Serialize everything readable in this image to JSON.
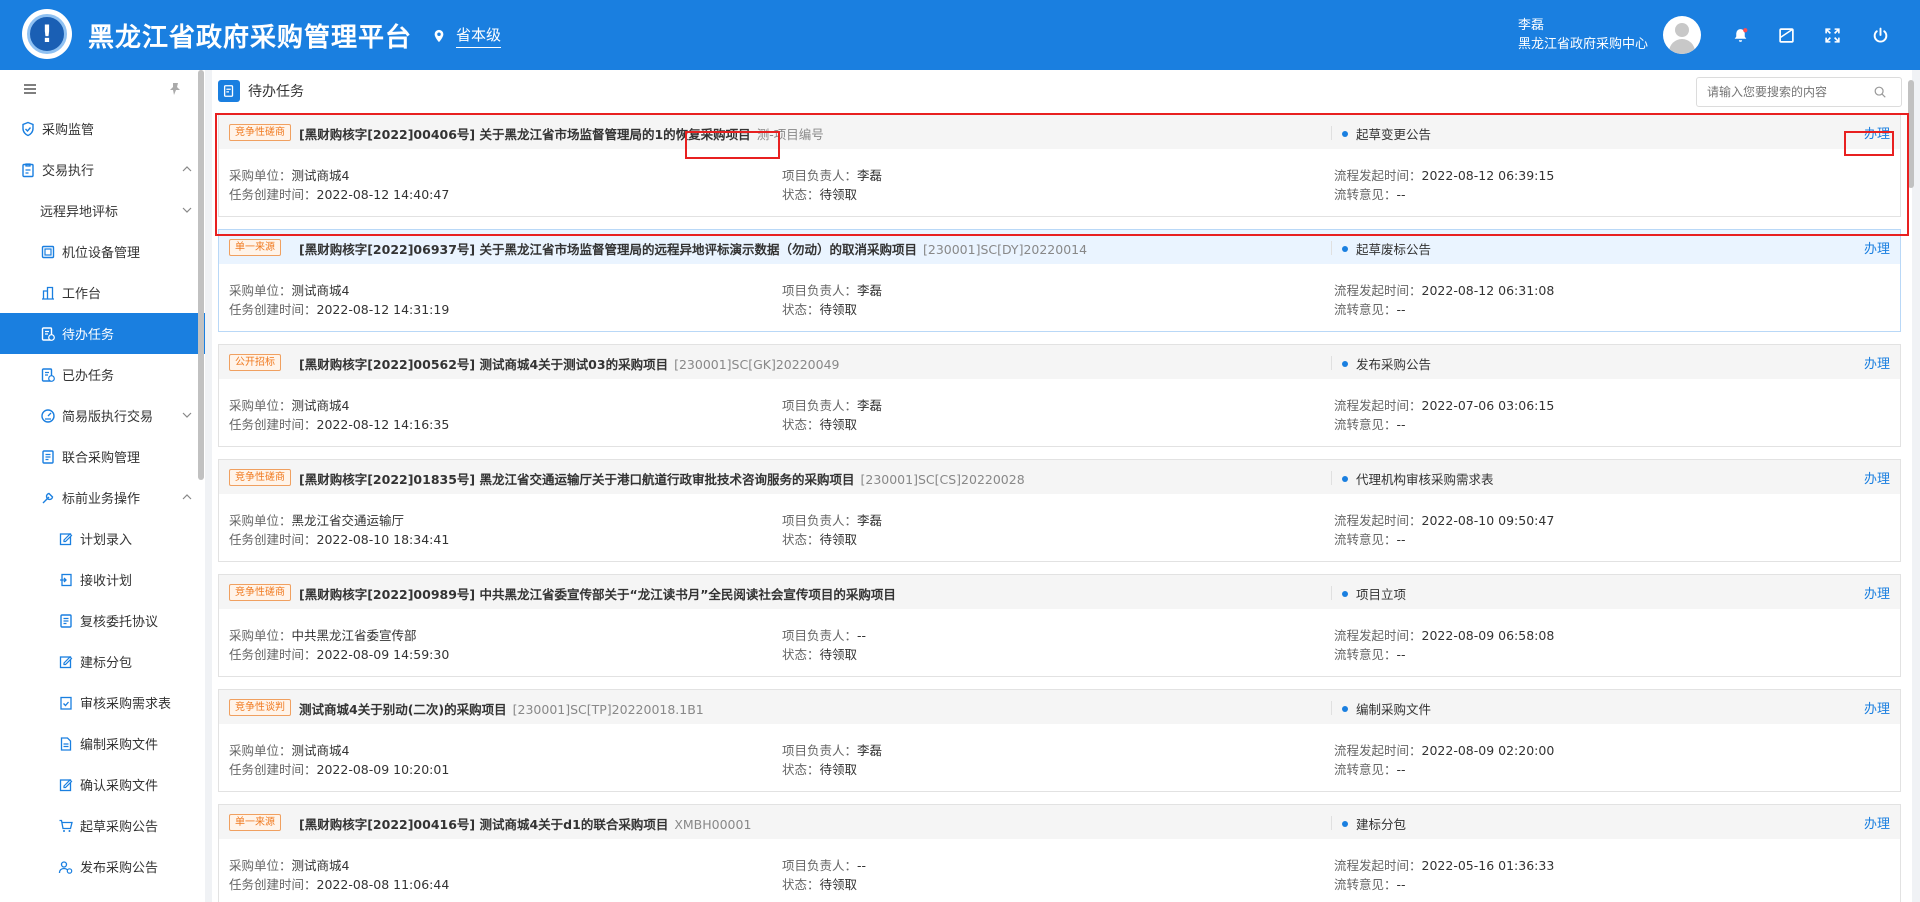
{
  "header": {
    "title": "黑龙江省政府采购管理平台",
    "region": "省本级",
    "user_name": "李磊",
    "user_org": "黑龙江省政府采购中心",
    "brand_color": "#1a7fe0"
  },
  "sidebar": {
    "items": [
      {
        "label": "采购监管",
        "icon": "shield-icon",
        "level": 1
      },
      {
        "label": "交易执行",
        "icon": "clipboard-icon",
        "level": 1,
        "expanded": true
      },
      {
        "label": "远程异地评标",
        "level": 2,
        "expanded": false
      },
      {
        "label": "机位设备管理",
        "icon": "device-icon",
        "level": 2
      },
      {
        "label": "工作台",
        "icon": "building-icon",
        "level": 2
      },
      {
        "label": "待办任务",
        "icon": "task-icon",
        "level": 2,
        "active": true
      },
      {
        "label": "已办任务",
        "icon": "task-done-icon",
        "level": 2
      },
      {
        "label": "简易版执行交易",
        "icon": "gauge-icon",
        "level": 2,
        "expanded": false
      },
      {
        "label": "联合采购管理",
        "icon": "doc-icon",
        "level": 2
      },
      {
        "label": "标前业务操作",
        "icon": "tools-icon",
        "level": 2,
        "expanded": true
      },
      {
        "label": "计划录入",
        "icon": "edit-icon",
        "level": 3
      },
      {
        "label": "接收计划",
        "icon": "import-icon",
        "level": 3
      },
      {
        "label": "复核委托协议",
        "icon": "doc-icon",
        "level": 3
      },
      {
        "label": "建标分包",
        "icon": "edit-icon",
        "level": 3
      },
      {
        "label": "审核采购需求表",
        "icon": "check-doc-icon",
        "level": 3
      },
      {
        "label": "编制采购文件",
        "icon": "file-icon",
        "level": 3
      },
      {
        "label": "确认采购文件",
        "icon": "edit-icon",
        "level": 3
      },
      {
        "label": "起草采购公告",
        "icon": "cart-icon",
        "level": 3
      },
      {
        "label": "发布采购公告",
        "icon": "users-icon",
        "level": 3
      }
    ]
  },
  "main": {
    "title": "待办任务",
    "search_placeholder": "请输入您要搜索的内容",
    "labels": {
      "unit": "采购单位：",
      "created": "任务创建时间：",
      "leader": "项目负责人：",
      "status": "状态：",
      "flow_time": "流程发起时间：",
      "opinion": "流转意见：",
      "handle": "办理"
    },
    "tasks": [
      {
        "tag": "竞争性磋商",
        "title": "[黑财购核字[2022]00406号] 关于黑龙江省市场监督管理局的1的恢复采购项目",
        "code": "测-项目编号",
        "stage": "起草变更公告",
        "unit": "测试商城4",
        "created": "2022-08-12 14:40:47",
        "leader": "李磊",
        "status": "待领取",
        "flow_time": "2022-08-12 06:39:15",
        "opinion": "--"
      },
      {
        "tag": "单一来源",
        "title": "[黑财购核字[2022]06937号] 关于黑龙江省市场监督管理局的远程异地评标演示数据（勿动）的取消采购项目",
        "code": "[230001]SC[DY]20220014",
        "stage": "起草废标公告",
        "unit": "测试商城4",
        "created": "2022-08-12 14:31:19",
        "leader": "李磊",
        "status": "待领取",
        "flow_time": "2022-08-12 06:31:08",
        "opinion": "--"
      },
      {
        "tag": "公开招标",
        "title": "[黑财购核字[2022]00562号] 测试商城4关于测试03的采购项目",
        "code": "[230001]SC[GK]20220049",
        "stage": "发布采购公告",
        "unit": "测试商城4",
        "created": "2022-08-12 14:16:35",
        "leader": "李磊",
        "status": "待领取",
        "flow_time": "2022-07-06 03:06:15",
        "opinion": "--"
      },
      {
        "tag": "竞争性磋商",
        "title": "[黑财购核字[2022]01835号] 黑龙江省交通运输厅关于港口航道行政审批技术咨询服务的采购项目",
        "code": "[230001]SC[CS]20220028",
        "stage": "代理机构审核采购需求表",
        "unit": "黑龙江省交通运输厅",
        "created": "2022-08-10 18:34:41",
        "leader": "李磊",
        "status": "待领取",
        "flow_time": "2022-08-10 09:50:47",
        "opinion": "--"
      },
      {
        "tag": "竞争性磋商",
        "title": "[黑财购核字[2022]00989号] 中共黑龙江省委宣传部关于“龙江读书月”全民阅读社会宣传项目的采购项目",
        "code": "",
        "stage": "项目立项",
        "unit": "中共黑龙江省委宣传部",
        "created": "2022-08-09 14:59:30",
        "leader": "--",
        "status": "待领取",
        "flow_time": "2022-08-09 06:58:08",
        "opinion": "--"
      },
      {
        "tag": "竞争性谈判",
        "title": "测试商城4关于别动(二次)的采购项目",
        "code": "[230001]SC[TP]20220018.1B1",
        "stage": "编制采购文件",
        "unit": "测试商城4",
        "created": "2022-08-09 10:20:01",
        "leader": "李磊",
        "status": "待领取",
        "flow_time": "2022-08-09 02:20:00",
        "opinion": "--"
      },
      {
        "tag": "单一来源",
        "title": "[黑财购核字[2022]00416号] 测试商城4关于d1的联合采购项目",
        "code": "XMBH00001",
        "stage": "建标分包",
        "unit": "测试商城4",
        "created": "2022-08-08 11:06:44",
        "leader": "--",
        "status": "待领取",
        "flow_time": "2022-05-16 01:36:33",
        "opinion": "--"
      }
    ]
  }
}
